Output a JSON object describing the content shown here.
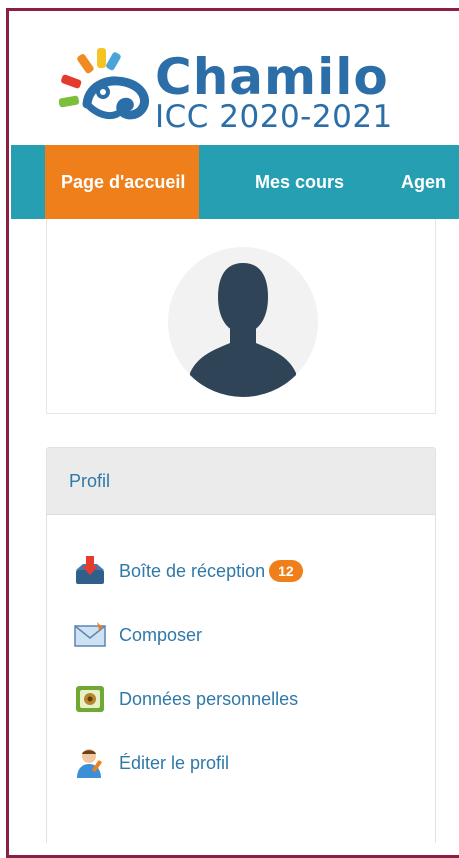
{
  "logo": {
    "title": "Chamilo",
    "subtitle": "ICC 2020-2021"
  },
  "nav": [
    {
      "label": "Page d'accueil",
      "active": true
    },
    {
      "label": "Mes cours"
    },
    {
      "label": "Agen"
    }
  ],
  "colors": {
    "brand_blue": "#2c6ea8",
    "navbar": "#279fb3",
    "active_tab": "#ef7f1a",
    "link": "#2f78a8",
    "badge": "#ef7f1a",
    "frame_border": "#8b1e44"
  },
  "avatar": {
    "icon": "user-silhouette-icon"
  },
  "profile": {
    "title": "Profil",
    "items": [
      {
        "label": "Boîte de réception",
        "badge": "12",
        "icon": "inbox-icon"
      },
      {
        "label": "Composer",
        "icon": "envelope-icon"
      },
      {
        "label": "Données personnelles",
        "icon": "personal-data-icon"
      },
      {
        "label": "Éditer le profil",
        "icon": "edit-profile-icon"
      }
    ]
  }
}
